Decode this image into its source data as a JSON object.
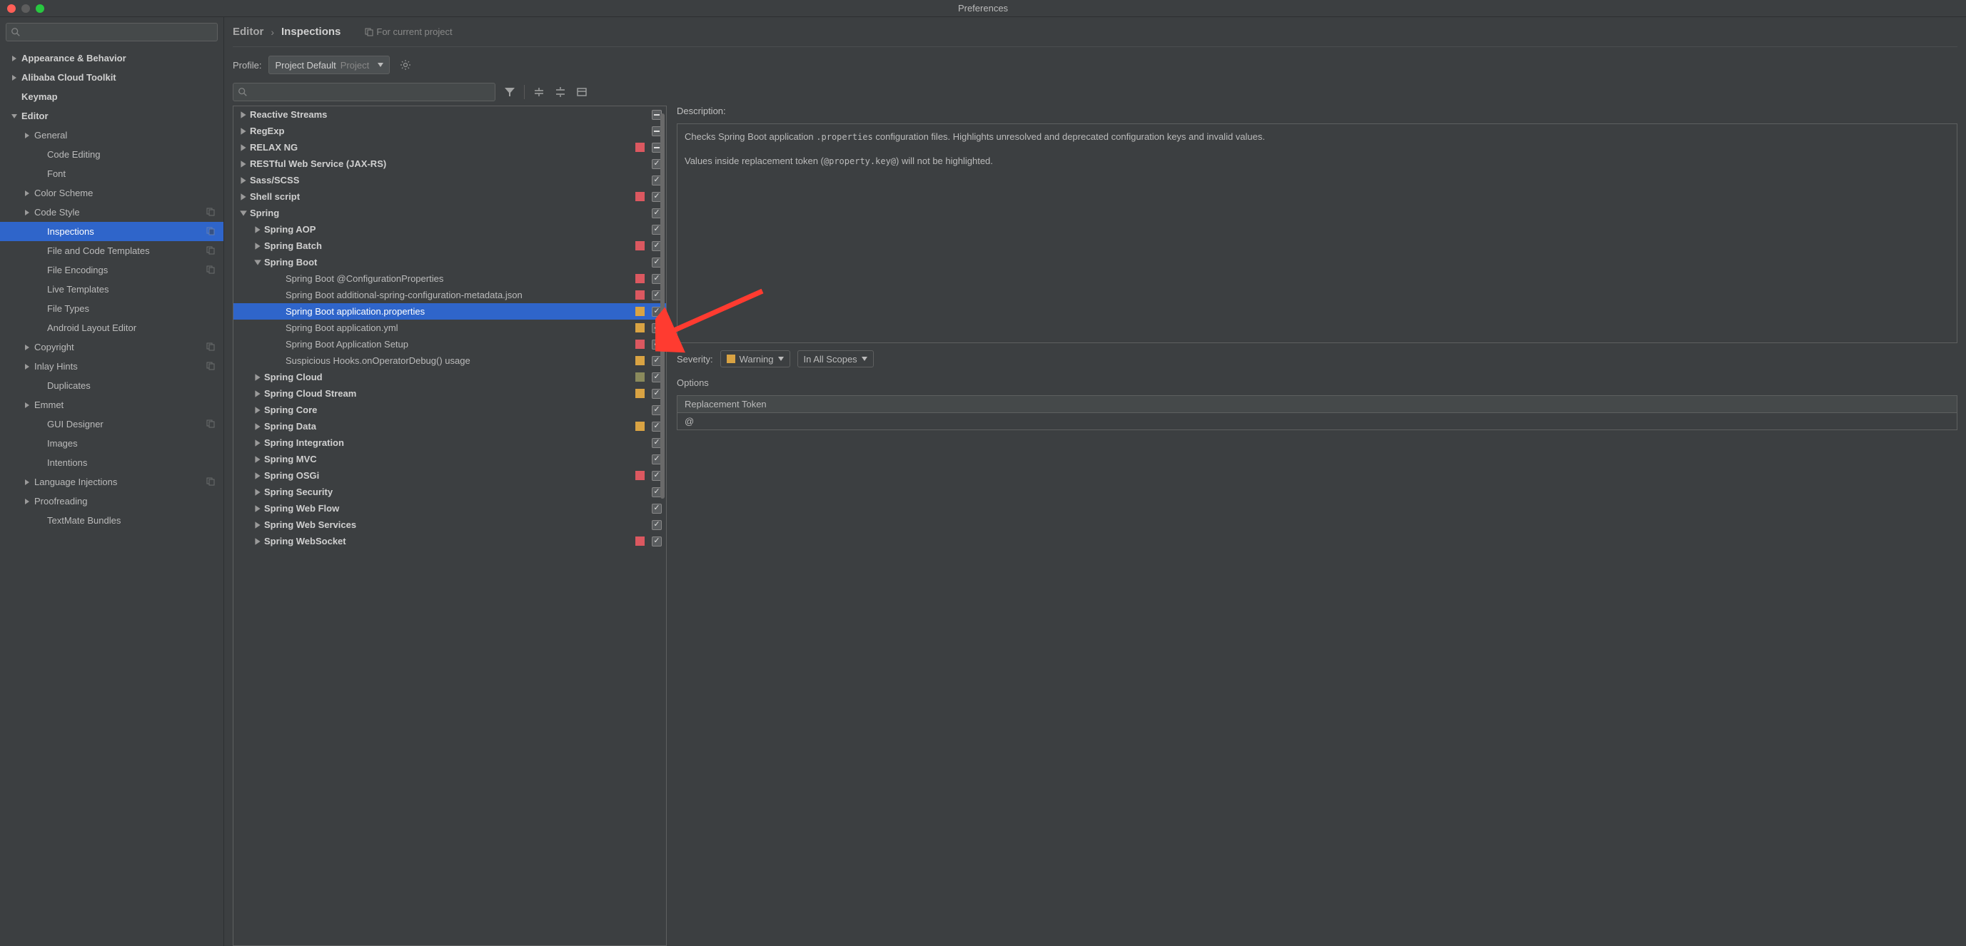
{
  "title": "Preferences",
  "sidebar": {
    "items": [
      {
        "label": "Appearance & Behavior",
        "bold": true,
        "arrow": "right",
        "indent": 0
      },
      {
        "label": "Alibaba Cloud Toolkit",
        "bold": true,
        "arrow": "right",
        "indent": 0
      },
      {
        "label": "Keymap",
        "bold": true,
        "arrow": "none",
        "indent": 0
      },
      {
        "label": "Editor",
        "bold": true,
        "arrow": "down",
        "indent": 0
      },
      {
        "label": "General",
        "bold": false,
        "arrow": "right",
        "indent": 1
      },
      {
        "label": "Code Editing",
        "bold": false,
        "arrow": "none",
        "indent": 2
      },
      {
        "label": "Font",
        "bold": false,
        "arrow": "none",
        "indent": 2
      },
      {
        "label": "Color Scheme",
        "bold": false,
        "arrow": "right",
        "indent": 1
      },
      {
        "label": "Code Style",
        "bold": false,
        "arrow": "right",
        "indent": 1,
        "copy": true
      },
      {
        "label": "Inspections",
        "bold": false,
        "arrow": "none",
        "indent": 2,
        "copy": true,
        "selected": true
      },
      {
        "label": "File and Code Templates",
        "bold": false,
        "arrow": "none",
        "indent": 2,
        "copy": true
      },
      {
        "label": "File Encodings",
        "bold": false,
        "arrow": "none",
        "indent": 2,
        "copy": true
      },
      {
        "label": "Live Templates",
        "bold": false,
        "arrow": "none",
        "indent": 2
      },
      {
        "label": "File Types",
        "bold": false,
        "arrow": "none",
        "indent": 2
      },
      {
        "label": "Android Layout Editor",
        "bold": false,
        "arrow": "none",
        "indent": 2
      },
      {
        "label": "Copyright",
        "bold": false,
        "arrow": "right",
        "indent": 1,
        "copy": true
      },
      {
        "label": "Inlay Hints",
        "bold": false,
        "arrow": "right",
        "indent": 1,
        "copy": true
      },
      {
        "label": "Duplicates",
        "bold": false,
        "arrow": "none",
        "indent": 2
      },
      {
        "label": "Emmet",
        "bold": false,
        "arrow": "right",
        "indent": 1
      },
      {
        "label": "GUI Designer",
        "bold": false,
        "arrow": "none",
        "indent": 2,
        "copy": true
      },
      {
        "label": "Images",
        "bold": false,
        "arrow": "none",
        "indent": 2
      },
      {
        "label": "Intentions",
        "bold": false,
        "arrow": "none",
        "indent": 2
      },
      {
        "label": "Language Injections",
        "bold": false,
        "arrow": "right",
        "indent": 1,
        "copy": true
      },
      {
        "label": "Proofreading",
        "bold": false,
        "arrow": "right",
        "indent": 1
      },
      {
        "label": "TextMate Bundles",
        "bold": false,
        "arrow": "none",
        "indent": 2
      }
    ]
  },
  "breadcrumb": {
    "parent": "Editor",
    "current": "Inspections",
    "hint": "For current project"
  },
  "profile": {
    "label": "Profile:",
    "name": "Project Default",
    "sub": "Project"
  },
  "inspections": [
    {
      "label": "Reactive Streams",
      "indent": 0,
      "arrow": "right",
      "chk": "mixed"
    },
    {
      "label": "RegExp",
      "indent": 0,
      "arrow": "right",
      "chk": "mixed"
    },
    {
      "label": "RELAX NG",
      "indent": 0,
      "arrow": "right",
      "swatch": "red",
      "chk": "mixed"
    },
    {
      "label": "RESTful Web Service (JAX-RS)",
      "indent": 0,
      "arrow": "right",
      "chk": "checked"
    },
    {
      "label": "Sass/SCSS",
      "indent": 0,
      "arrow": "right",
      "chk": "checked"
    },
    {
      "label": "Shell script",
      "indent": 0,
      "arrow": "right",
      "swatch": "red",
      "chk": "checked"
    },
    {
      "label": "Spring",
      "indent": 0,
      "arrow": "down",
      "chk": "checked"
    },
    {
      "label": "Spring AOP",
      "indent": 1,
      "arrow": "right",
      "chk": "checked"
    },
    {
      "label": "Spring Batch",
      "indent": 1,
      "arrow": "right",
      "swatch": "red",
      "chk": "checked"
    },
    {
      "label": "Spring Boot",
      "indent": 1,
      "arrow": "down",
      "chk": "checked"
    },
    {
      "label": "Spring Boot @ConfigurationProperties",
      "indent": 2,
      "leaf": true,
      "swatch": "red",
      "chk": "checked"
    },
    {
      "label": "Spring Boot additional-spring-configuration-metadata.json",
      "indent": 2,
      "leaf": true,
      "swatch": "red",
      "chk": "checked"
    },
    {
      "label": "Spring Boot application.properties",
      "indent": 2,
      "leaf": true,
      "swatch": "yellow",
      "chk": "checked",
      "selected": true
    },
    {
      "label": "Spring Boot application.yml",
      "indent": 2,
      "leaf": true,
      "swatch": "yellow",
      "chk": "checked"
    },
    {
      "label": "Spring Boot Application Setup",
      "indent": 2,
      "leaf": true,
      "swatch": "red",
      "chk": "checked"
    },
    {
      "label": "Suspicious Hooks.onOperatorDebug() usage",
      "indent": 2,
      "leaf": true,
      "swatch": "yellow",
      "chk": "checked"
    },
    {
      "label": "Spring Cloud",
      "indent": 1,
      "arrow": "right",
      "swatch": "olive",
      "chk": "checked"
    },
    {
      "label": "Spring Cloud Stream",
      "indent": 1,
      "arrow": "right",
      "swatch": "yellow",
      "chk": "checked"
    },
    {
      "label": "Spring Core",
      "indent": 1,
      "arrow": "right",
      "chk": "checked"
    },
    {
      "label": "Spring Data",
      "indent": 1,
      "arrow": "right",
      "swatch": "yellow",
      "chk": "checked"
    },
    {
      "label": "Spring Integration",
      "indent": 1,
      "arrow": "right",
      "chk": "checked"
    },
    {
      "label": "Spring MVC",
      "indent": 1,
      "arrow": "right",
      "chk": "checked"
    },
    {
      "label": "Spring OSGi",
      "indent": 1,
      "arrow": "right",
      "swatch": "red",
      "chk": "checked"
    },
    {
      "label": "Spring Security",
      "indent": 1,
      "arrow": "right",
      "chk": "checked"
    },
    {
      "label": "Spring Web Flow",
      "indent": 1,
      "arrow": "right",
      "chk": "checked"
    },
    {
      "label": "Spring Web Services",
      "indent": 1,
      "arrow": "right",
      "chk": "checked"
    },
    {
      "label": "Spring WebSocket",
      "indent": 1,
      "arrow": "right",
      "swatch": "red",
      "chk": "checked"
    }
  ],
  "detail": {
    "desc_label": "Description:",
    "desc_p1a": "Checks Spring Boot application ",
    "desc_code1": ".properties",
    "desc_p1b": " configuration files. Highlights unresolved and deprecated configuration keys and invalid values.",
    "desc_p2a": "Values inside replacement token (",
    "desc_code2": "@property.key@",
    "desc_p2b": ") will not be highlighted.",
    "sev_label": "Severity:",
    "sev_value": "Warning",
    "scope_value": "In All Scopes",
    "opt_label": "Options",
    "opt_head": "Replacement Token",
    "opt_value": "@"
  }
}
